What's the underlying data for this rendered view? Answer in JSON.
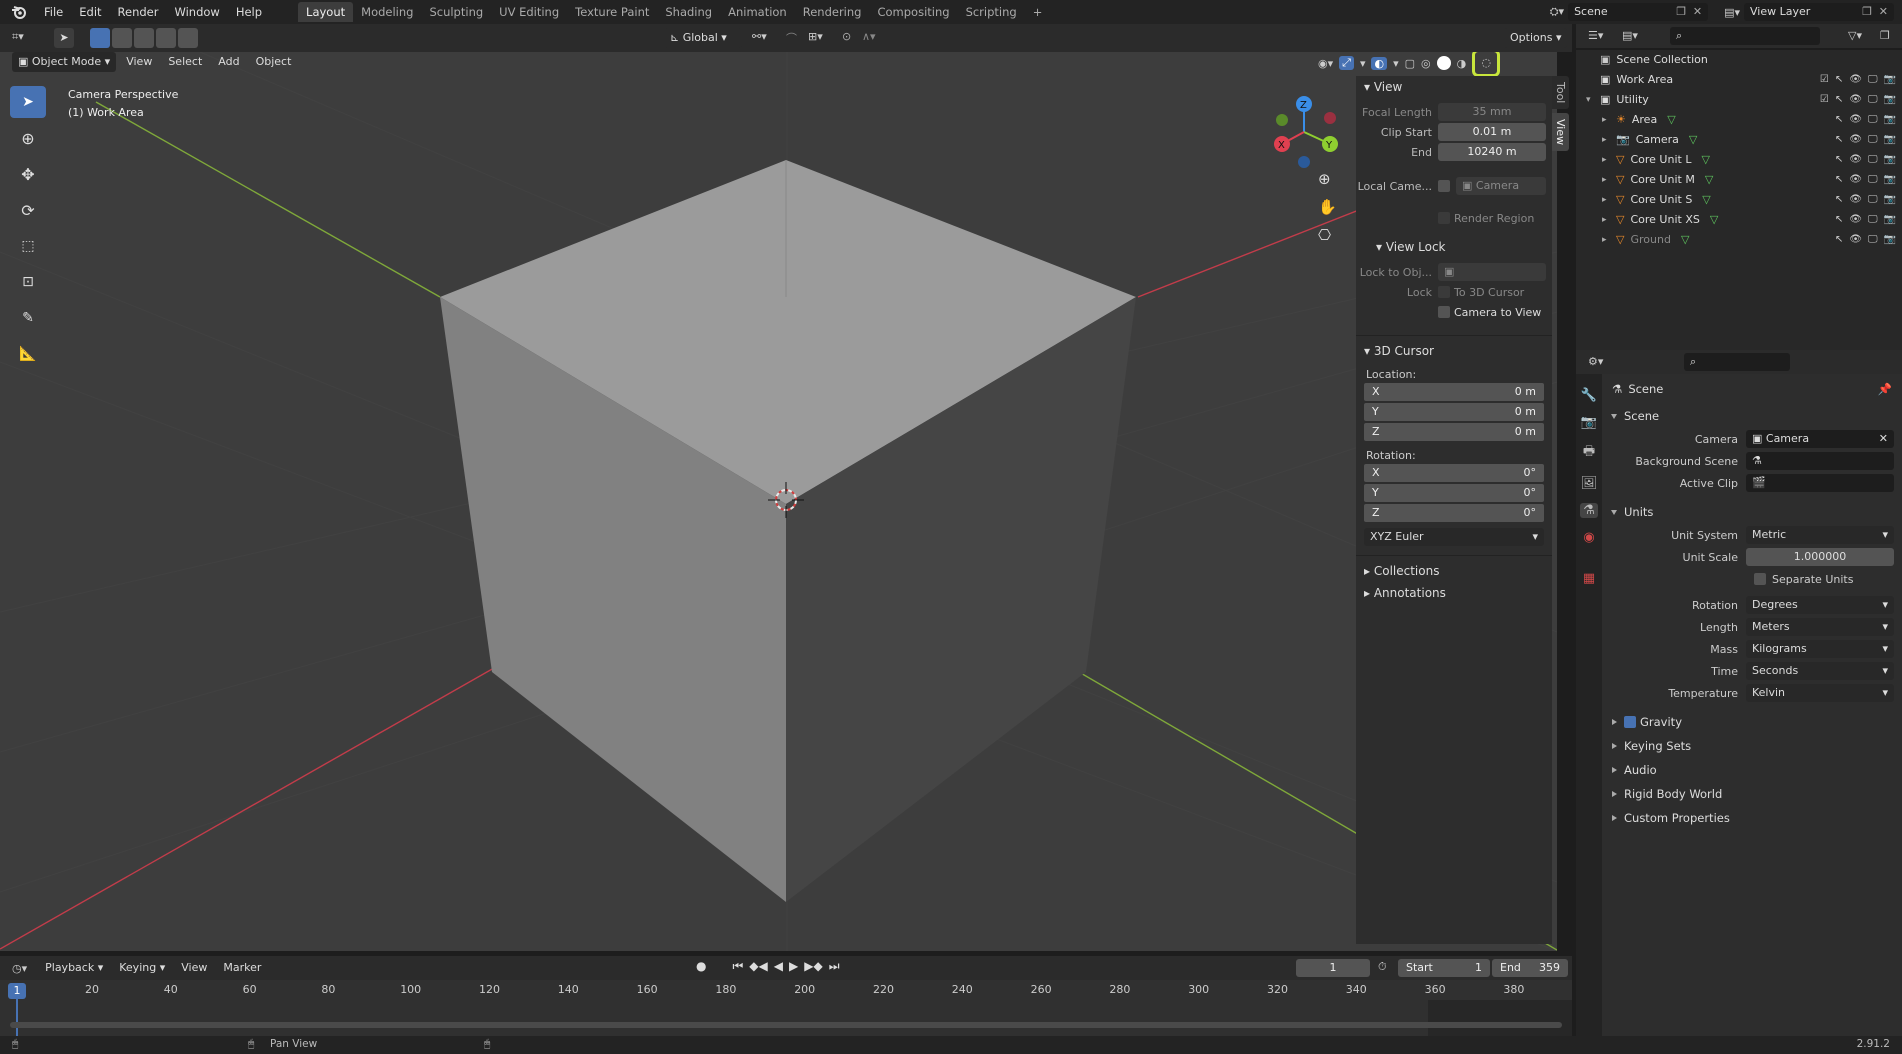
{
  "topbar": {
    "menus": [
      "File",
      "Edit",
      "Render",
      "Window",
      "Help"
    ],
    "workspaces": [
      "Layout",
      "Modeling",
      "Sculpting",
      "UV Editing",
      "Texture Paint",
      "Shading",
      "Animation",
      "Rendering",
      "Compositing",
      "Scripting"
    ],
    "add_tab": "+",
    "scene": "Scene",
    "view_layer": "View Layer"
  },
  "viewport": {
    "mode": "Object Mode",
    "menus": [
      "View",
      "Select",
      "Add",
      "Object"
    ],
    "transform_orientation": "Global",
    "options": "Options",
    "overlay_title": "Camera Perspective",
    "overlay_sub": "(1) Work Area",
    "gizmo_axes": {
      "x": "X",
      "y": "Y",
      "z": "Z"
    }
  },
  "npanel": {
    "view_header": "View",
    "focal_length_label": "Focal Length",
    "focal_length": "35 mm",
    "clip_start_label": "Clip Start",
    "clip_start": "0.01 m",
    "end_label": "End",
    "end": "10240 m",
    "local_camera_label": "Local Came...",
    "local_camera_value": "Camera",
    "render_region": "Render Region",
    "view_lock_header": "View Lock",
    "lock_to_obj_label": "Lock to Obj...",
    "lock_label": "Lock",
    "to_3d_cursor": "To 3D Cursor",
    "camera_to_view": "Camera to View",
    "cursor_header": "3D Cursor",
    "location_label": "Location:",
    "loc": [
      {
        "axis": "X",
        "value": "0 m"
      },
      {
        "axis": "Y",
        "value": "0 m"
      },
      {
        "axis": "Z",
        "value": "0 m"
      }
    ],
    "rotation_label": "Rotation:",
    "rot": [
      {
        "axis": "X",
        "value": "0°"
      },
      {
        "axis": "Y",
        "value": "0°"
      },
      {
        "axis": "Z",
        "value": "0°"
      }
    ],
    "rotation_mode": "XYZ Euler",
    "collections": "Collections",
    "annotations": "Annotations",
    "tabs": [
      "Tool",
      "View"
    ]
  },
  "outliner": {
    "root": "Scene Collection",
    "items": [
      {
        "name": "Work Area",
        "indent": 1
      },
      {
        "name": "Utility",
        "indent": 1
      },
      {
        "name": "Area",
        "indent": 2
      },
      {
        "name": "Camera",
        "indent": 2
      },
      {
        "name": "Core Unit L",
        "indent": 2
      },
      {
        "name": "Core Unit M",
        "indent": 2
      },
      {
        "name": "Core Unit S",
        "indent": 2
      },
      {
        "name": "Core Unit XS",
        "indent": 2
      },
      {
        "name": "Ground",
        "indent": 2
      }
    ]
  },
  "properties": {
    "context": "Scene",
    "scene_section": "Scene",
    "camera_label": "Camera",
    "camera_value": "Camera",
    "background_scene_label": "Background Scene",
    "active_clip_label": "Active Clip",
    "units_section": "Units",
    "unit_system_label": "Unit System",
    "unit_system": "Metric",
    "unit_scale_label": "Unit Scale",
    "unit_scale": "1.000000",
    "separate_units": "Separate Units",
    "rotation_label": "Rotation",
    "rotation": "Degrees",
    "length_label": "Length",
    "length": "Meters",
    "mass_label": "Mass",
    "mass": "Kilograms",
    "time_label": "Time",
    "time": "Seconds",
    "temperature_label": "Temperature",
    "temperature": "Kelvin",
    "gravity": "Gravity",
    "keying_sets": "Keying Sets",
    "audio": "Audio",
    "rigid_body_world": "Rigid Body World",
    "custom_properties": "Custom Properties"
  },
  "timeline": {
    "menus": [
      "Playback",
      "Keying",
      "View",
      "Marker"
    ],
    "current_frame": "1",
    "start_label": "Start",
    "start": "1",
    "end_label": "End",
    "end": "359",
    "ticks": [
      "20",
      "40",
      "60",
      "80",
      "100",
      "120",
      "140",
      "160",
      "180",
      "200",
      "220",
      "240",
      "260",
      "280",
      "300",
      "320",
      "340",
      "360",
      "380"
    ],
    "playhead": "1"
  },
  "statusbar": {
    "pan_view": "Pan View",
    "version": "2.91.2"
  },
  "colors": {
    "accent": "#4772b3",
    "highlight_ring": "#c8e63c",
    "x_axis": "#e04050",
    "y_axis": "#8fcf30",
    "z_axis": "#3a8ee8"
  }
}
